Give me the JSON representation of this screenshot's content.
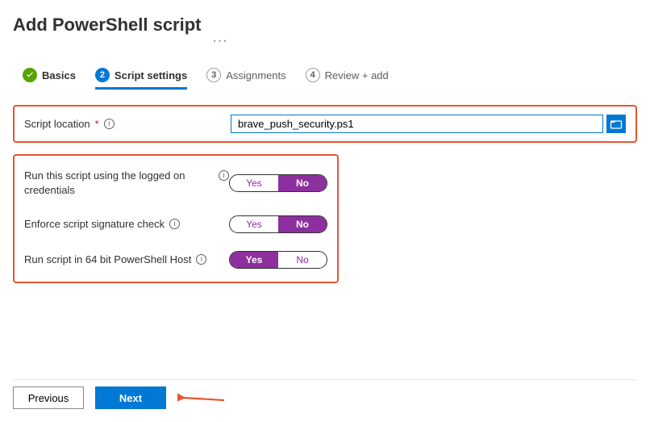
{
  "header": {
    "title": "Add PowerShell script"
  },
  "stepper": {
    "s1": {
      "num": "1",
      "label": "Basics"
    },
    "s2": {
      "num": "2",
      "label": "Script settings"
    },
    "s3": {
      "num": "3",
      "label": "Assignments"
    },
    "s4": {
      "num": "4",
      "label": "Review + add"
    }
  },
  "fields": {
    "script_location": {
      "label": "Script location",
      "required": "*",
      "value": "brave_push_security.ps1"
    }
  },
  "options": {
    "opt1": {
      "label": "Run this script using the logged on credentials",
      "yes": "Yes",
      "no": "No",
      "selected": "no"
    },
    "opt2": {
      "label": "Enforce script signature check",
      "yes": "Yes",
      "no": "No",
      "selected": "no"
    },
    "opt3": {
      "label": "Run script in 64 bit PowerShell Host",
      "yes": "Yes",
      "no": "No",
      "selected": "yes"
    }
  },
  "footer": {
    "previous": "Previous",
    "next": "Next"
  }
}
